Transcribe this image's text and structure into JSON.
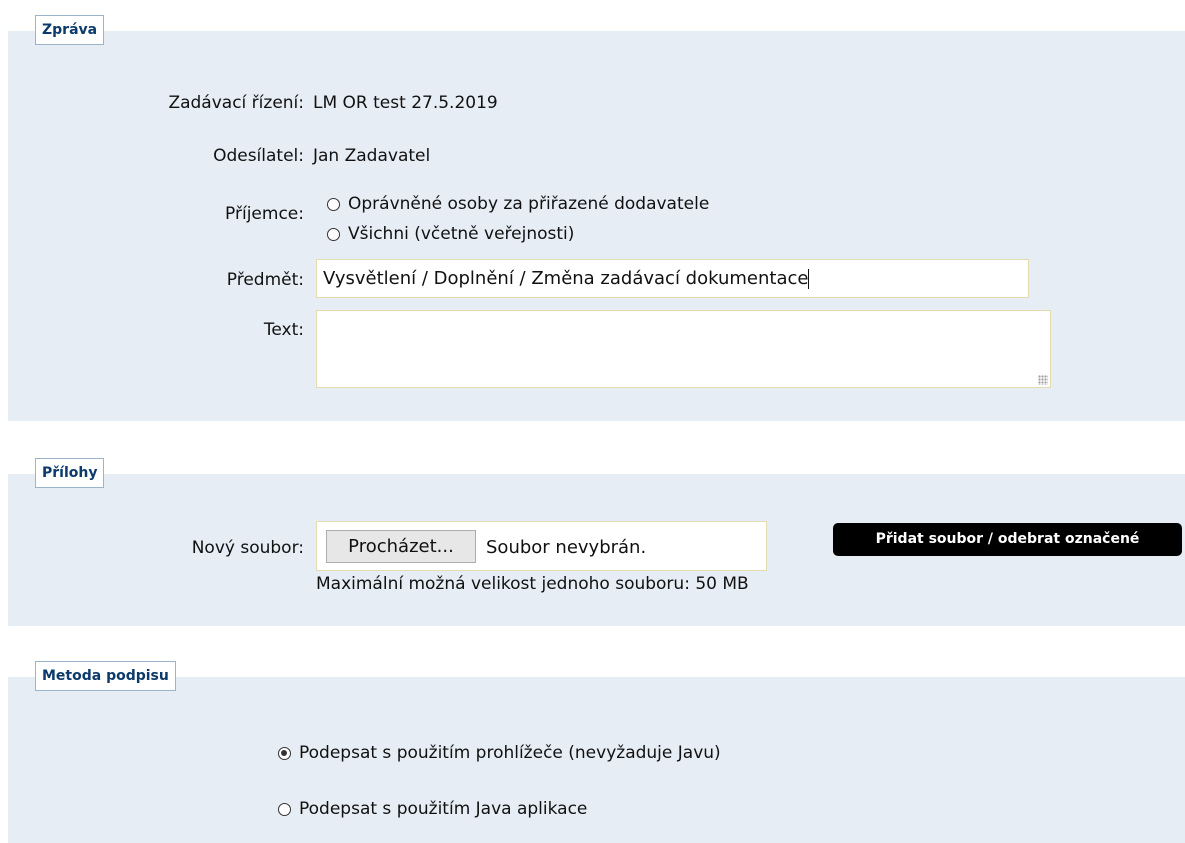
{
  "message_section": {
    "legend": "Zpráva",
    "procurement_label": "Zadávací řízení:",
    "procurement_value": "LM OR test 27.5.2019",
    "sender_label": "Odesílatel:",
    "sender_value": "Jan Zadavatel",
    "recipient_label": "Příjemce:",
    "recipient_options": [
      {
        "label": "Oprávněné osoby za přiřazené dodavatele",
        "selected": false
      },
      {
        "label": "Všichni (včetně veřejnosti)",
        "selected": false
      }
    ],
    "subject_label": "Předmět:",
    "subject_value": "Vysvětlení / Doplnění / Změna zadávací dokumentace",
    "text_label": "Text:",
    "text_value": ""
  },
  "attachments_section": {
    "legend": "Přílohy",
    "new_file_label": "Nový soubor:",
    "browse_label": "Procházet...",
    "file_status": "Soubor nevybrán.",
    "max_size_note": "Maximální možná velikost jednoho souboru: 50 MB",
    "add_button_label": "Přidat soubor / odebrat označené"
  },
  "signature_section": {
    "legend": "Metoda podpisu",
    "options": [
      {
        "label": "Podepsat s použitím prohlížeče (nevyžaduje Javu)",
        "selected": true
      },
      {
        "label": "Podepsat s použitím Java aplikace",
        "selected": false
      }
    ]
  }
}
